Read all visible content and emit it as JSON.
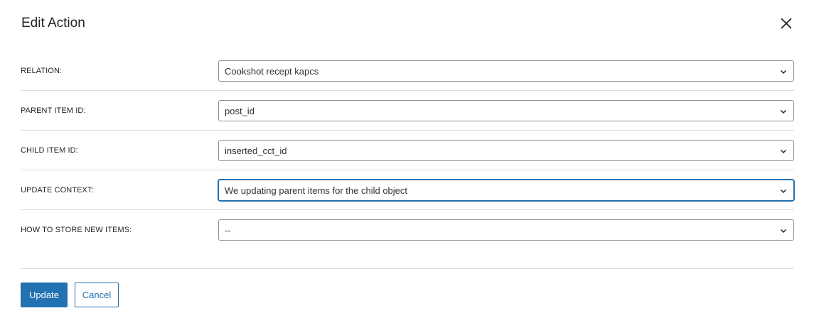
{
  "dialog": {
    "title": "Edit Action",
    "close_icon": "close-icon"
  },
  "fields": [
    {
      "label": "RELATION:",
      "value": "Cookshot recept kapcs"
    },
    {
      "label": "PARENT ITEM ID:",
      "value": "post_id"
    },
    {
      "label": "CHILD ITEM ID:",
      "value": "inserted_cct_id"
    },
    {
      "label": "UPDATE CONTEXT:",
      "value": "We updating parent items for the child object"
    },
    {
      "label": "HOW TO STORE NEW ITEMS:",
      "value": "--"
    }
  ],
  "footer": {
    "update_label": "Update",
    "cancel_label": "Cancel"
  },
  "colors": {
    "accent": "#2271b1",
    "border": "#8c8f94",
    "divider": "#dcdcde"
  }
}
